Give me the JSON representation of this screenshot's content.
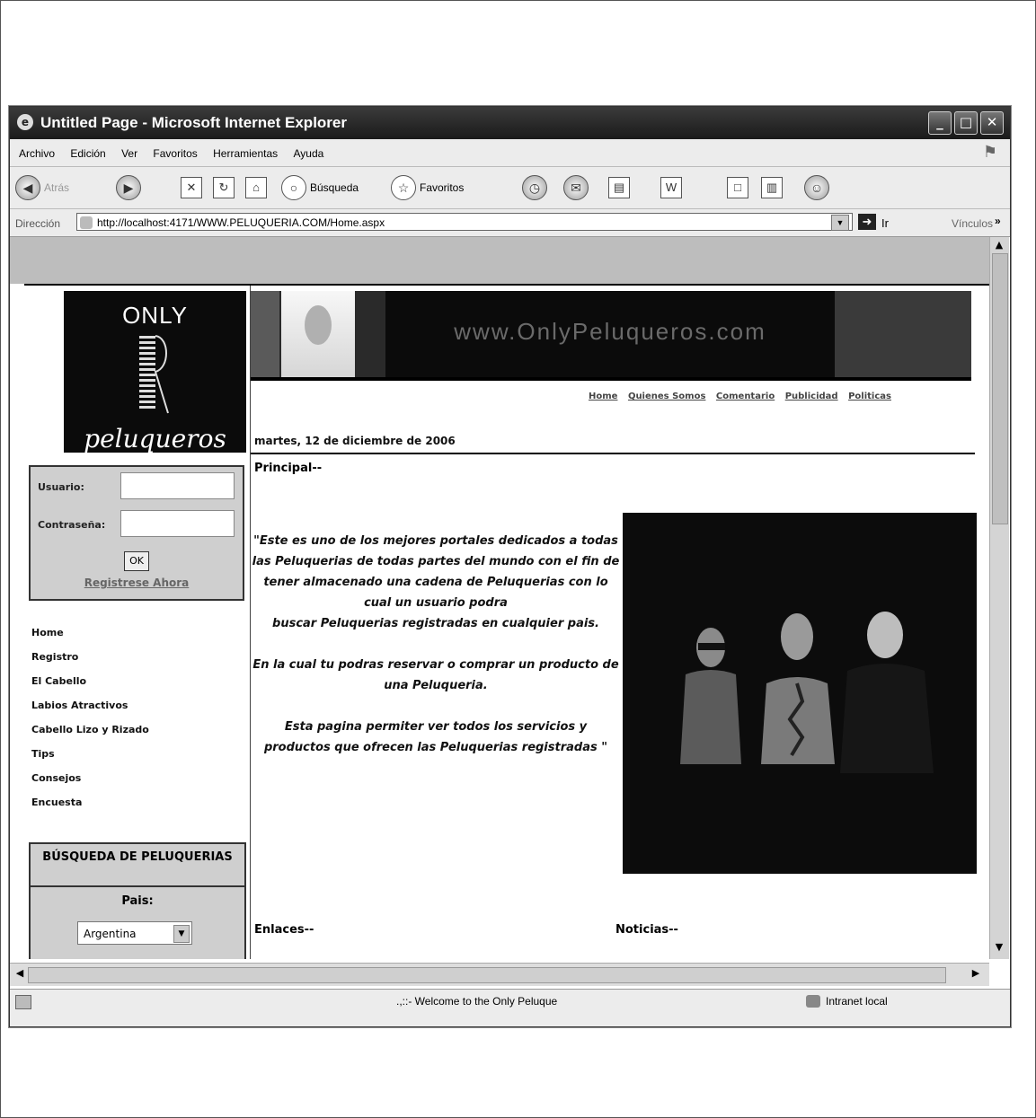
{
  "window": {
    "title": "Untitled Page - Microsoft Internet Explorer",
    "controls": {
      "minimize": "_",
      "maximize": "□",
      "close": "✕"
    }
  },
  "menu": [
    "Archivo",
    "Edición",
    "Ver",
    "Favoritos",
    "Herramientas",
    "Ayuda"
  ],
  "toolbar": {
    "back": "Atrás",
    "search": "Búsqueda",
    "favorites": "Favoritos"
  },
  "address": {
    "label": "Dirección",
    "url": "http://localhost:4171/WWW.PELUQUERIA.COM/Home.aspx",
    "go": "Ir",
    "links": "Vínculos",
    "links_chevron": "»"
  },
  "site": {
    "logo": {
      "top": "ONLY",
      "bottom": "peluqueros"
    },
    "login": {
      "user_label": "Usuario:",
      "password_label": "Contraseña:",
      "ok": "OK",
      "register": "Registrese Ahora"
    },
    "nav": [
      "Home",
      "Registro",
      "El Cabello",
      "Labios Atractivos",
      "Cabello Lizo y Rizado",
      "Tips",
      "Consejos",
      "Encuesta"
    ],
    "search": {
      "title": "BÚSQUEDA DE PELUQUERIAS",
      "country_label": "Pais:",
      "country_value": "Argentina"
    },
    "banner_text": "www.OnlyPeluqueros.com",
    "topnav": [
      "Home",
      "Quienes Somos",
      "Comentario",
      "Publicidad",
      "Politicas"
    ],
    "date": "martes, 12 de diciembre de 2006",
    "principal": "Principal--",
    "quote": {
      "p1": "\"Este es uno de los mejores portales dedicados a todas las Peluquerias de todas partes del mundo con el fin de  tener almacenado una cadena de Peluquerias con lo cual un usuario podra",
      "p1b": "buscar Peluquerias registradas en cualquier pais.",
      "p2": "En la cual tu podras reservar o comprar un producto de una Peluqueria.",
      "p3": "Esta pagina permiter ver todos los servicios y productos que ofrecen las Peluquerias registradas \""
    },
    "enlaces": "Enlaces--",
    "noticias": "Noticias--"
  },
  "status": {
    "text": ".,::- Welcome to the Only Peluque",
    "zone": "Intranet local"
  },
  "colors": {
    "titlebar": "#1a1a1a",
    "chrome": "#ececec",
    "panel": "#cfcfcf",
    "photo_bg": "#0c0c0c"
  }
}
